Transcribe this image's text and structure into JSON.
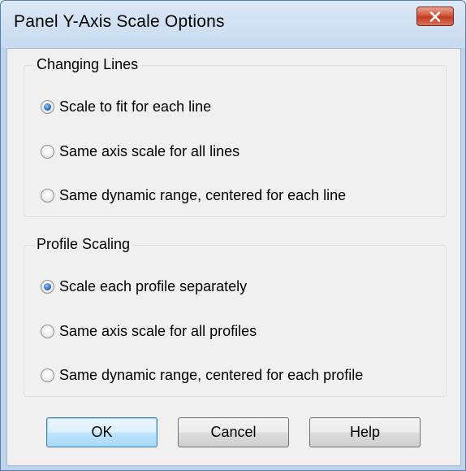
{
  "window": {
    "title": "Panel Y-Axis Scale Options"
  },
  "icons": {
    "close": "close-icon",
    "radio": "radio-button"
  },
  "colors": {
    "close_button": "#c9452c",
    "titlebar": "#c7daef",
    "default_button_border": "#3c7fb1",
    "radio_selected": "#2f73c6"
  },
  "changing_lines": {
    "title": "Changing Lines",
    "options": [
      {
        "label": "Scale to fit for each line",
        "checked": true
      },
      {
        "label": "Same axis scale for all lines",
        "checked": false
      },
      {
        "label": "Same dynamic range, centered for each line",
        "checked": false
      }
    ]
  },
  "profile_scaling": {
    "title": "Profile Scaling",
    "options": [
      {
        "label": "Scale each profile separately",
        "checked": true
      },
      {
        "label": "Same axis scale for all profiles",
        "checked": false
      },
      {
        "label": "Same dynamic range, centered for each profile",
        "checked": false
      }
    ]
  },
  "buttons": {
    "ok": "OK",
    "cancel": "Cancel",
    "help": "Help"
  }
}
